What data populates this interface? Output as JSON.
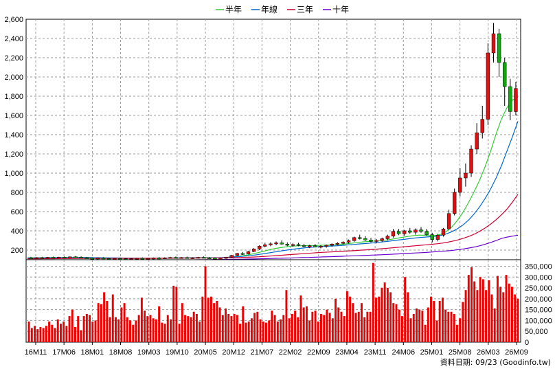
{
  "chart_data": [
    {
      "type": "candlestick",
      "title": "",
      "x_tick_labels": [
        "16M11",
        "17M06",
        "18M01",
        "18M08",
        "19M03",
        "19M10",
        "20M05",
        "20M12",
        "21M07",
        "22M02",
        "22M09",
        "23M04",
        "23M11",
        "24M06",
        "25M01",
        "25M08",
        "26M03",
        "26M09"
      ],
      "y_tick_labels": [
        "200",
        "400",
        "600",
        "800",
        "1,000",
        "1,200",
        "1,400",
        "1,600",
        "1,800",
        "2,000",
        "2,200",
        "2,400",
        "2,600"
      ],
      "ylim": [
        100,
        2600
      ],
      "grid": true,
      "legend_position": "top-center",
      "legend": [
        {
          "name": "半年",
          "color": "#33cc33"
        },
        {
          "name": "年線",
          "color": "#0066cc"
        },
        {
          "name": "三年",
          "color": "#cc0033"
        },
        {
          "name": "十年",
          "color": "#6600cc"
        }
      ],
      "up_color": "#dd1111",
      "down_color": "#11aa11",
      "candles": [
        {
          "o": 120,
          "h": 130,
          "l": 112,
          "c": 118
        },
        {
          "o": 118,
          "h": 126,
          "l": 110,
          "c": 122
        },
        {
          "o": 122,
          "h": 130,
          "l": 115,
          "c": 119
        },
        {
          "o": 119,
          "h": 128,
          "l": 112,
          "c": 125
        },
        {
          "o": 125,
          "h": 132,
          "l": 118,
          "c": 121
        },
        {
          "o": 121,
          "h": 130,
          "l": 114,
          "c": 127
        },
        {
          "o": 127,
          "h": 134,
          "l": 120,
          "c": 124
        },
        {
          "o": 124,
          "h": 133,
          "l": 116,
          "c": 130
        },
        {
          "o": 130,
          "h": 138,
          "l": 122,
          "c": 126
        },
        {
          "o": 126,
          "h": 134,
          "l": 118,
          "c": 121
        },
        {
          "o": 121,
          "h": 128,
          "l": 110,
          "c": 115
        },
        {
          "o": 115,
          "h": 124,
          "l": 106,
          "c": 112
        },
        {
          "o": 112,
          "h": 122,
          "l": 104,
          "c": 118
        },
        {
          "o": 118,
          "h": 126,
          "l": 108,
          "c": 111
        },
        {
          "o": 111,
          "h": 120,
          "l": 100,
          "c": 106
        },
        {
          "o": 106,
          "h": 116,
          "l": 98,
          "c": 112
        },
        {
          "o": 112,
          "h": 122,
          "l": 104,
          "c": 109
        },
        {
          "o": 109,
          "h": 118,
          "l": 100,
          "c": 104
        },
        {
          "o": 104,
          "h": 114,
          "l": 96,
          "c": 110
        },
        {
          "o": 110,
          "h": 120,
          "l": 102,
          "c": 114
        },
        {
          "o": 114,
          "h": 124,
          "l": 104,
          "c": 108
        },
        {
          "o": 108,
          "h": 118,
          "l": 98,
          "c": 113
        },
        {
          "o": 113,
          "h": 123,
          "l": 105,
          "c": 118
        },
        {
          "o": 118,
          "h": 128,
          "l": 110,
          "c": 115
        },
        {
          "o": 115,
          "h": 125,
          "l": 107,
          "c": 120
        },
        {
          "o": 120,
          "h": 130,
          "l": 112,
          "c": 124
        },
        {
          "o": 124,
          "h": 134,
          "l": 116,
          "c": 119
        },
        {
          "o": 119,
          "h": 128,
          "l": 110,
          "c": 123
        },
        {
          "o": 123,
          "h": 132,
          "l": 114,
          "c": 117
        },
        {
          "o": 117,
          "h": 126,
          "l": 108,
          "c": 121
        },
        {
          "o": 121,
          "h": 130,
          "l": 112,
          "c": 125
        },
        {
          "o": 125,
          "h": 134,
          "l": 116,
          "c": 120
        },
        {
          "o": 120,
          "h": 128,
          "l": 110,
          "c": 116
        },
        {
          "o": 116,
          "h": 124,
          "l": 102,
          "c": 108
        },
        {
          "o": 108,
          "h": 118,
          "l": 96,
          "c": 114
        },
        {
          "o": 114,
          "h": 130,
          "l": 108,
          "c": 126
        },
        {
          "o": 126,
          "h": 150,
          "l": 120,
          "c": 145
        },
        {
          "o": 145,
          "h": 170,
          "l": 138,
          "c": 165
        },
        {
          "o": 165,
          "h": 180,
          "l": 150,
          "c": 160
        },
        {
          "o": 160,
          "h": 190,
          "l": 155,
          "c": 185
        },
        {
          "o": 185,
          "h": 220,
          "l": 178,
          "c": 212
        },
        {
          "o": 212,
          "h": 250,
          "l": 200,
          "c": 240
        },
        {
          "o": 240,
          "h": 275,
          "l": 228,
          "c": 255
        },
        {
          "o": 255,
          "h": 282,
          "l": 240,
          "c": 265
        },
        {
          "o": 265,
          "h": 290,
          "l": 250,
          "c": 275
        },
        {
          "o": 275,
          "h": 300,
          "l": 258,
          "c": 262
        },
        {
          "o": 262,
          "h": 280,
          "l": 240,
          "c": 250
        },
        {
          "o": 250,
          "h": 270,
          "l": 235,
          "c": 258
        },
        {
          "o": 258,
          "h": 275,
          "l": 240,
          "c": 248
        },
        {
          "o": 248,
          "h": 265,
          "l": 228,
          "c": 238
        },
        {
          "o": 238,
          "h": 255,
          "l": 220,
          "c": 245
        },
        {
          "o": 245,
          "h": 262,
          "l": 228,
          "c": 236
        },
        {
          "o": 236,
          "h": 252,
          "l": 218,
          "c": 240
        },
        {
          "o": 240,
          "h": 258,
          "l": 224,
          "c": 250
        },
        {
          "o": 250,
          "h": 270,
          "l": 236,
          "c": 262
        },
        {
          "o": 262,
          "h": 282,
          "l": 248,
          "c": 270
        },
        {
          "o": 270,
          "h": 292,
          "l": 255,
          "c": 282
        },
        {
          "o": 282,
          "h": 310,
          "l": 268,
          "c": 298
        },
        {
          "o": 298,
          "h": 340,
          "l": 286,
          "c": 330
        },
        {
          "o": 330,
          "h": 360,
          "l": 310,
          "c": 320
        },
        {
          "o": 320,
          "h": 345,
          "l": 295,
          "c": 305
        },
        {
          "o": 305,
          "h": 325,
          "l": 280,
          "c": 290
        },
        {
          "o": 290,
          "h": 315,
          "l": 270,
          "c": 300
        },
        {
          "o": 300,
          "h": 330,
          "l": 282,
          "c": 318
        },
        {
          "o": 318,
          "h": 360,
          "l": 300,
          "c": 345
        },
        {
          "o": 345,
          "h": 420,
          "l": 330,
          "c": 395
        },
        {
          "o": 395,
          "h": 420,
          "l": 355,
          "c": 370
        },
        {
          "o": 370,
          "h": 410,
          "l": 350,
          "c": 400
        },
        {
          "o": 400,
          "h": 430,
          "l": 370,
          "c": 385
        },
        {
          "o": 385,
          "h": 425,
          "l": 360,
          "c": 410
        },
        {
          "o": 410,
          "h": 440,
          "l": 380,
          "c": 395
        },
        {
          "o": 395,
          "h": 420,
          "l": 350,
          "c": 360
        },
        {
          "o": 360,
          "h": 380,
          "l": 280,
          "c": 310
        },
        {
          "o": 310,
          "h": 370,
          "l": 290,
          "c": 355
        },
        {
          "o": 355,
          "h": 430,
          "l": 340,
          "c": 420
        },
        {
          "o": 420,
          "h": 620,
          "l": 410,
          "c": 580
        },
        {
          "o": 580,
          "h": 840,
          "l": 560,
          "c": 800
        },
        {
          "o": 800,
          "h": 1050,
          "l": 760,
          "c": 950
        },
        {
          "o": 950,
          "h": 1100,
          "l": 860,
          "c": 1000
        },
        {
          "o": 1000,
          "h": 1290,
          "l": 960,
          "c": 1250
        },
        {
          "o": 1250,
          "h": 1520,
          "l": 1200,
          "c": 1420
        },
        {
          "o": 1420,
          "h": 1700,
          "l": 1360,
          "c": 1560
        },
        {
          "o": 1560,
          "h": 2350,
          "l": 1500,
          "c": 2250
        },
        {
          "o": 2250,
          "h": 2560,
          "l": 2150,
          "c": 2450
        },
        {
          "o": 2450,
          "h": 2500,
          "l": 2000,
          "c": 2150
        },
        {
          "o": 2150,
          "h": 2200,
          "l": 1700,
          "c": 1900
        },
        {
          "o": 1900,
          "h": 1980,
          "l": 1550,
          "c": 1640
        },
        {
          "o": 1640,
          "h": 1950,
          "l": 1600,
          "c": 1880
        }
      ],
      "series": [
        {
          "name": "半年",
          "values": [
            120,
            120,
            121,
            121,
            122,
            122,
            123,
            123,
            124,
            124,
            123,
            122,
            121,
            120,
            118,
            117,
            116,
            115,
            114,
            114,
            113,
            113,
            113,
            114,
            115,
            116,
            117,
            118,
            119,
            120,
            120,
            121,
            121,
            120,
            119,
            120,
            123,
            128,
            134,
            141,
            150,
            162,
            176,
            190,
            205,
            217,
            226,
            234,
            240,
            244,
            246,
            247,
            248,
            249,
            251,
            253,
            256,
            260,
            266,
            273,
            280,
            286,
            290,
            294,
            298,
            304,
            312,
            322,
            332,
            342,
            350,
            356,
            354,
            350,
            352,
            364,
            392,
            440,
            508,
            590,
            690,
            800,
            920,
            1060,
            1220,
            1400,
            1560,
            1680,
            1760,
            1790
          ]
        },
        {
          "name": "年線",
          "values": [
            118,
            118,
            119,
            119,
            120,
            120,
            121,
            121,
            122,
            122,
            122,
            122,
            121,
            121,
            120,
            119,
            119,
            118,
            117,
            117,
            116,
            116,
            116,
            116,
            116,
            117,
            117,
            118,
            118,
            119,
            119,
            120,
            120,
            120,
            120,
            121,
            123,
            126,
            129,
            133,
            138,
            144,
            151,
            159,
            168,
            177,
            186,
            195,
            203,
            211,
            218,
            224,
            229,
            233,
            237,
            240,
            243,
            246,
            250,
            254,
            259,
            264,
            268,
            273,
            278,
            284,
            290,
            297,
            304,
            311,
            318,
            325,
            331,
            335,
            339,
            345,
            355,
            371,
            394,
            425,
            465,
            515,
            578,
            652,
            738,
            836,
            950,
            1080,
            1230,
            1380,
            1540
          ]
        },
        {
          "name": "三年",
          "values": [
            110,
            110,
            110,
            111,
            111,
            111,
            112,
            112,
            112,
            113,
            113,
            113,
            113,
            113,
            113,
            113,
            114,
            114,
            114,
            114,
            114,
            114,
            115,
            115,
            115,
            115,
            116,
            116,
            116,
            117,
            117,
            117,
            118,
            118,
            118,
            119,
            119,
            120,
            121,
            122,
            124,
            126,
            128,
            131,
            134,
            138,
            142,
            146,
            150,
            154,
            158,
            162,
            166,
            170,
            174,
            177,
            180,
            183,
            186,
            189,
            192,
            196,
            200,
            203,
            207,
            211,
            215,
            220,
            225,
            230,
            235,
            240,
            245,
            250,
            255,
            260,
            266,
            273,
            282,
            294,
            308,
            324,
            344,
            368,
            398,
            432,
            472,
            518,
            570,
            628,
            700,
            780
          ]
        },
        {
          "name": "十年",
          "values": [
            82,
            83,
            83,
            84,
            84,
            85,
            85,
            86,
            86,
            87,
            87,
            88,
            88,
            89,
            89,
            90,
            90,
            91,
            92,
            92,
            93,
            93,
            94,
            94,
            95,
            95,
            96,
            97,
            97,
            98,
            98,
            99,
            100,
            100,
            101,
            102,
            102,
            103,
            104,
            105,
            106,
            107,
            108,
            109,
            111,
            112,
            114,
            115,
            117,
            118,
            120,
            122,
            123,
            125,
            127,
            129,
            131,
            133,
            135,
            137,
            139,
            141,
            143,
            146,
            148,
            150,
            152,
            155,
            158,
            161,
            164,
            167,
            170,
            173,
            176,
            180,
            184,
            188,
            192,
            198,
            205,
            213,
            222,
            233,
            246,
            262,
            280,
            300,
            322,
            335,
            345,
            355
          ]
        }
      ]
    },
    {
      "type": "bar",
      "title": "",
      "series_name": "",
      "y_tick_labels": [
        "0",
        "50,000",
        "100,000",
        "150,000",
        "200,000",
        "250,000",
        "300,000",
        "350,000"
      ],
      "ylim": [
        0,
        380000
      ],
      "color": "#ee0000",
      "values": [
        95000,
        65000,
        75000,
        60000,
        70000,
        65000,
        75000,
        95000,
        80000,
        65000,
        105000,
        85000,
        95000,
        75000,
        120000,
        150000,
        70000,
        120000,
        55000,
        120000,
        130000,
        125000,
        95000,
        100000,
        180000,
        175000,
        230000,
        190000,
        115000,
        220000,
        115000,
        105000,
        160000,
        180000,
        115000,
        100000,
        80000,
        100000,
        125000,
        205000,
        145000,
        120000,
        125000,
        110000,
        105000,
        165000,
        90000,
        85000,
        125000,
        105000,
        260000,
        255000,
        85000,
        180000,
        125000,
        120000,
        115000,
        140000,
        130000,
        95000,
        210000,
        350000,
        205000,
        210000,
        180000,
        190000,
        160000,
        125000,
        155000,
        130000,
        120000,
        130000,
        125000,
        85000,
        165000,
        90000,
        95000,
        110000,
        135000,
        140000,
        105000,
        95000,
        90000,
        100000,
        145000,
        125000,
        95000,
        105000,
        125000,
        240000,
        110000,
        130000,
        145000,
        115000,
        215000,
        160000,
        165000,
        100000,
        140000,
        145000,
        95000,
        130000,
        125000,
        150000,
        135000,
        110000,
        200000,
        160000,
        140000,
        120000,
        235000,
        210000,
        180000,
        135000,
        140000,
        180000,
        115000,
        140000,
        140000,
        365000,
        205000,
        210000,
        250000,
        275000,
        250000,
        230000,
        180000,
        175000,
        150000,
        120000,
        300000,
        230000,
        110000,
        130000,
        155000,
        150000,
        145000,
        80000,
        160000,
        210000,
        190000,
        100000,
        190000,
        205000,
        150000,
        140000,
        140000,
        130000,
        80000,
        110000,
        185000,
        240000,
        310000,
        345000,
        280000,
        240000,
        300000,
        290000,
        240000,
        285000,
        220000,
        155000,
        305000,
        255000,
        230000,
        310000,
        270000,
        255000,
        220000,
        200000
      ]
    }
  ],
  "footer": {
    "source": "資料日期: 09/23 (Goodinfo.tw)"
  }
}
